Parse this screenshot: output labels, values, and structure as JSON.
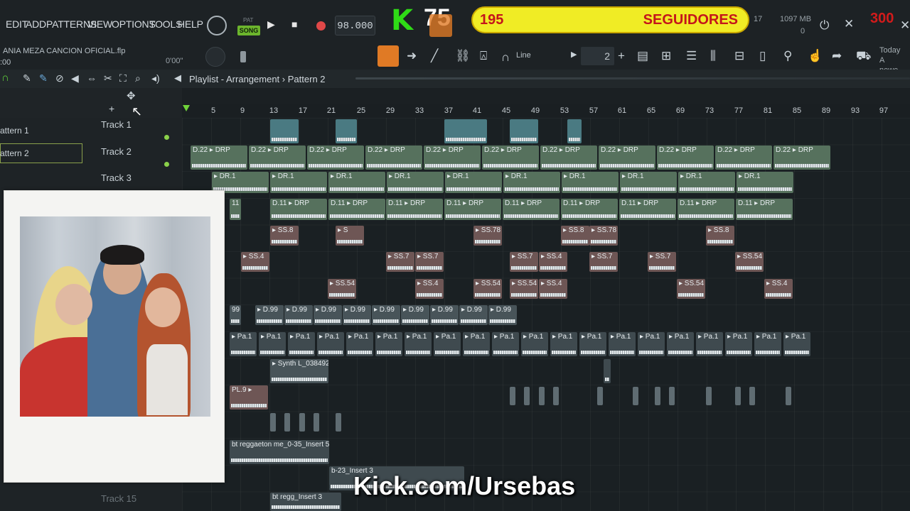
{
  "menu": [
    "EDIT",
    "ADD",
    "PATTERNS",
    "VIEW",
    "OPTIONS",
    "TOOLS",
    "HELP"
  ],
  "transport": {
    "mode_top": "PAT",
    "mode": "SONG",
    "play": "▶",
    "stop": "■",
    "tempo": "98.000"
  },
  "overlay": {
    "kick_letter": "K",
    "viewer_count": "75",
    "followers_count": "195",
    "followers_label": "SEGUIDORES",
    "followers_goal": "300",
    "stream_url": "Kick.com/Ursebas"
  },
  "stats": {
    "cpu": "17",
    "memory": "1097 MB",
    "poly": "0"
  },
  "file": {
    "name": "ANIA MEZA CANCION OFICIAL.flp",
    "time_left": ":00",
    "time_mid": "0'00\""
  },
  "toolbar": {
    "snap": "Line",
    "pattern_number": "2",
    "hint_line1": "Today",
    "hint_line2": "A newe..."
  },
  "playlist": {
    "title": "Playlist - Arrangement",
    "separator": "›",
    "pattern": "Pattern 2"
  },
  "patterns": [
    "attern 1",
    "attern 2"
  ],
  "tracks": [
    "Track 1",
    "Track 2",
    "Track 3",
    "Track 15"
  ],
  "ruler": [
    "5",
    "9",
    "13",
    "17",
    "21",
    "25",
    "29",
    "33",
    "37",
    "41",
    "45",
    "49",
    "53",
    "57",
    "61",
    "65",
    "69",
    "73",
    "77",
    "81",
    "85",
    "89",
    "93",
    "97"
  ],
  "clips": {
    "drp": "D.22 ▸ DRP",
    "dr1": "▸ DR.1",
    "d11": "D.11 ▸ DRP",
    "ss8": "▸ SS.8",
    "ss78": "▸ SS.78",
    "ss4": "▸ SS.4",
    "ss7": "▸ SS.7",
    "ss54": "▸ SS.54",
    "d99": "▸ D.99",
    "pa1": "▸ Pa.1",
    "synth": "▸ Synth L_038492",
    "pl9": "PL.9 ▸",
    "eleven": "11",
    "ninety9": "99",
    "s": "▸ S",
    "reggaeton1": "bt reggaeton me_0-35_Insert 5",
    "reggaeton2": "bt regg_Insert 3",
    "reggaeton3": "b-23_Insert 3"
  }
}
